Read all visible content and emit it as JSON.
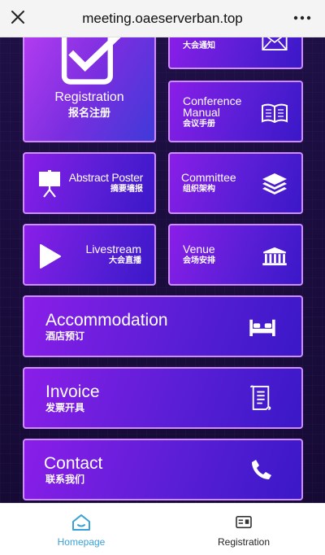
{
  "browser": {
    "url": "meeting.oaeserverban.top"
  },
  "tiles": {
    "registration": {
      "en": "Registration",
      "zh": "报名注册",
      "icon": "checkbox-icon"
    },
    "notice": {
      "zh": "大会通知",
      "icon": "envelope-icon"
    },
    "manual": {
      "en_line1": "Conference",
      "en_line2": "Manual",
      "zh": "会议手册",
      "icon": "book-icon"
    },
    "abstract": {
      "en": "Abstract Poster",
      "zh": "摘要墙报",
      "icon": "presentation-board-icon"
    },
    "committee": {
      "en": "Committee",
      "zh": "组织架构",
      "icon": "layers-icon"
    },
    "livestream": {
      "en": "Livestream",
      "zh": "大会直播",
      "icon": "play-icon"
    },
    "venue": {
      "en": "Venue",
      "zh": "会场安排",
      "icon": "building-icon"
    },
    "accommodation": {
      "en": "Accommodation",
      "zh": "酒店预订",
      "icon": "bed-icon"
    },
    "invoice": {
      "en": "Invoice",
      "zh": "发票开具",
      "icon": "receipt-icon"
    },
    "contact": {
      "en": "Contact",
      "zh": "联系我们",
      "icon": "phone-icon"
    }
  },
  "bottom_nav": {
    "items": [
      {
        "label": "Homepage",
        "icon": "home-icon",
        "active": true
      },
      {
        "label": "Registration",
        "icon": "id-card-icon",
        "active": false
      }
    ]
  },
  "colors": {
    "accent_active": "#3aa0d8",
    "tile_border": "#cf8cff",
    "tile_gradient_start": "#8a1ee8",
    "tile_gradient_end": "#3a18c8"
  }
}
